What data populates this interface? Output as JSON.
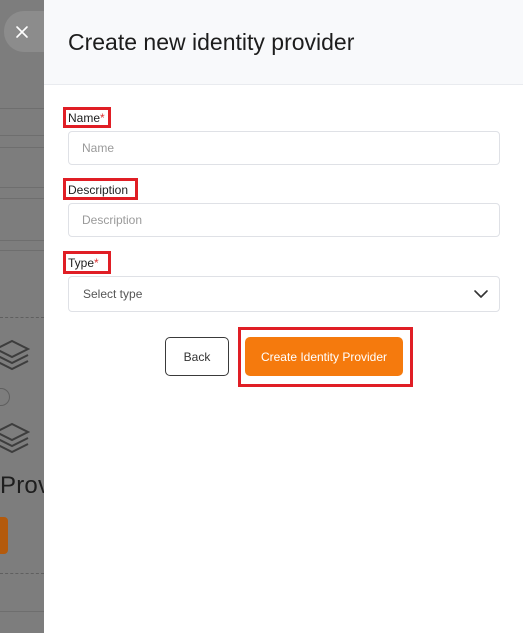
{
  "background": {
    "partial_title": "Prov"
  },
  "drawer": {
    "title": "Create new identity provider",
    "fields": {
      "name": {
        "label": "Name",
        "required_mark": "*",
        "placeholder": "Name",
        "value": ""
      },
      "description": {
        "label": "Description",
        "placeholder": "Description",
        "value": ""
      },
      "type": {
        "label": "Type",
        "required_mark": "*",
        "selected": "Select type"
      }
    },
    "buttons": {
      "back": "Back",
      "create": "Create Identity Provider"
    }
  },
  "colors": {
    "accent": "#f57a0d",
    "highlight": "#e01e25"
  },
  "icons": {
    "close": "close-icon",
    "dropdown": "chevron-down-icon",
    "stack": "layers-icon"
  }
}
